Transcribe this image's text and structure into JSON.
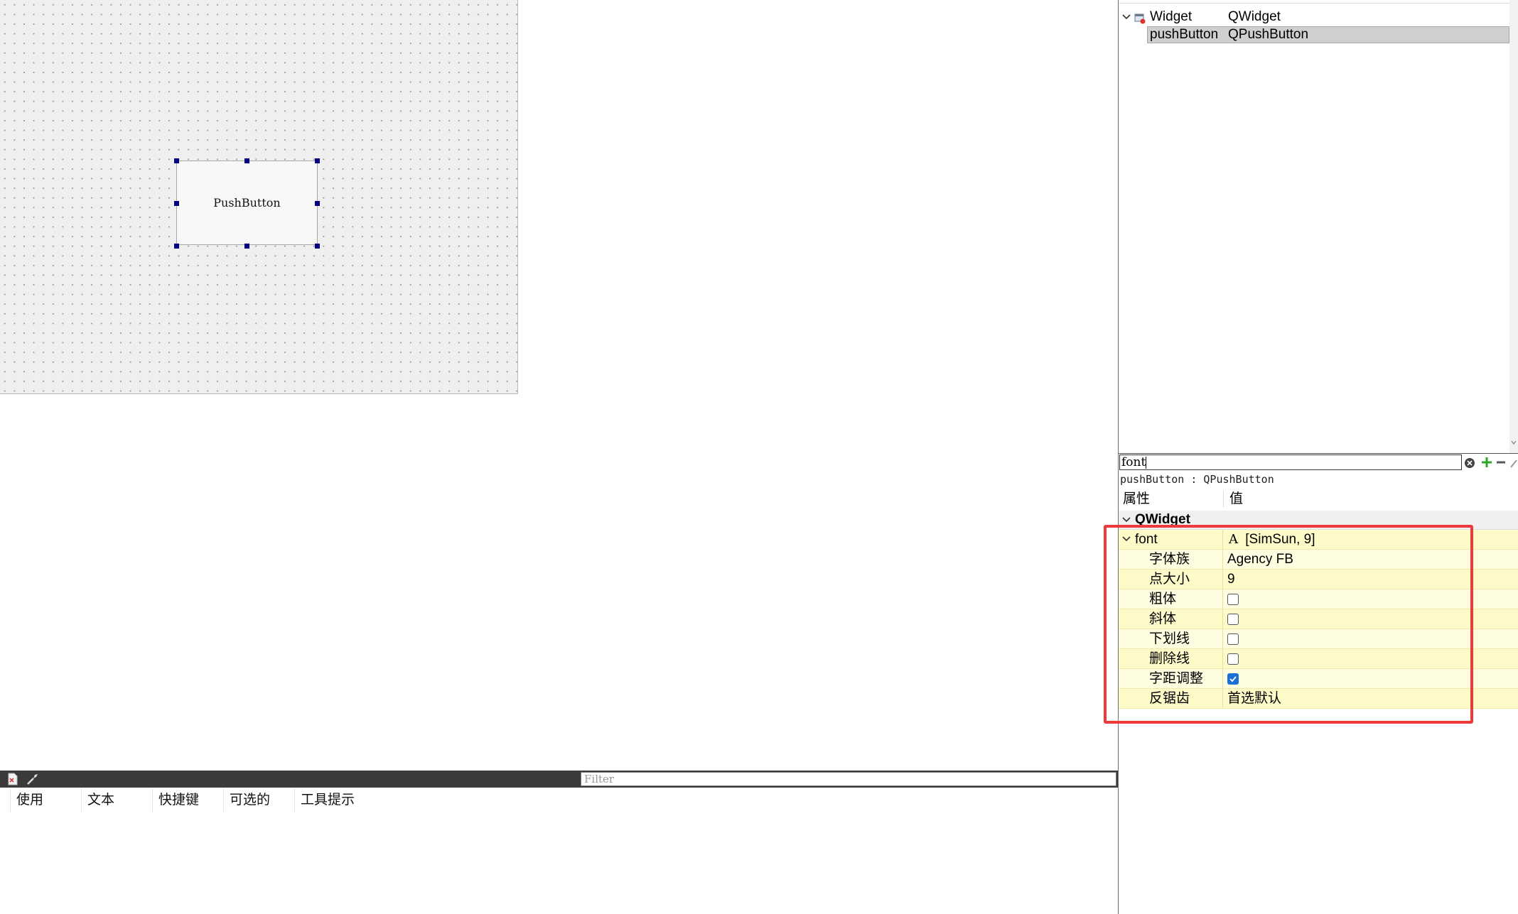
{
  "canvas": {
    "push_button_label": "PushButton"
  },
  "action_editor": {
    "filter_placeholder": "Filter",
    "columns": [
      "使用",
      "文本",
      "快捷键",
      "可选的",
      "工具提示"
    ]
  },
  "object_inspector": {
    "rows": [
      {
        "name": "Widget",
        "class": "QWidget"
      },
      {
        "name": "pushButton",
        "class": "QPushButton"
      }
    ]
  },
  "property_editor": {
    "filter_value": "font",
    "object_class_label": "pushButton : QPushButton",
    "header": {
      "property": "属性",
      "value": "值"
    },
    "group": "QWidget",
    "font_property": {
      "name": "font",
      "value": "[SimSun, 9]"
    },
    "sub_properties": [
      {
        "name": "字体族",
        "value": "Agency FB"
      },
      {
        "name": "点大小",
        "value": "9"
      },
      {
        "name": "粗体",
        "checked": false
      },
      {
        "name": "斜体",
        "checked": false
      },
      {
        "name": "下划线",
        "checked": false
      },
      {
        "name": "删除线",
        "checked": false
      },
      {
        "name": "字距调整",
        "checked": true
      },
      {
        "name": "反锯齿",
        "value": "首选默认"
      }
    ]
  },
  "colors": {
    "highlight": "#ee3a3a",
    "property_row_yellow": "#fffbc8",
    "selection": "#cfcfcf",
    "handle": "#000080"
  }
}
